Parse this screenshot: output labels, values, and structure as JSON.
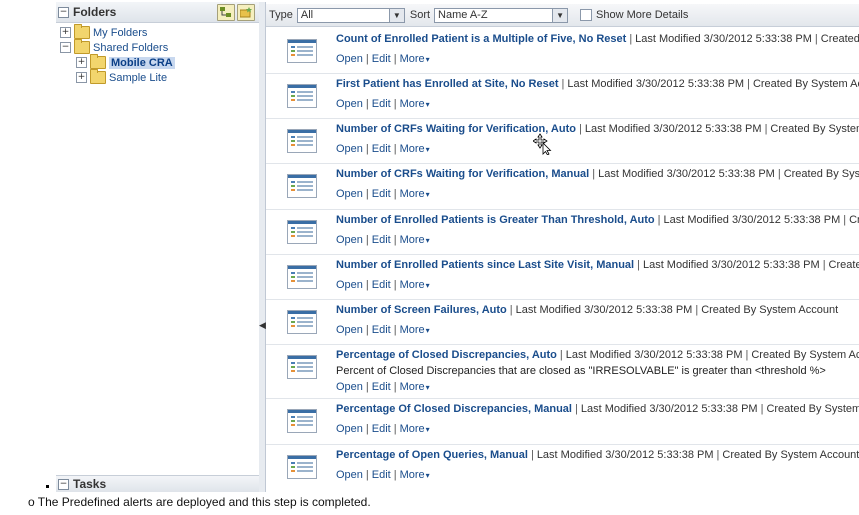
{
  "left_panel": {
    "folders_title": "Folders",
    "tree": [
      {
        "label": "My Folders",
        "level": 1,
        "expander": "+"
      },
      {
        "label": "Shared Folders",
        "level": 1,
        "expander": "−"
      },
      {
        "label": "Mobile CRA",
        "level": 2,
        "expander": "+",
        "selected": true
      },
      {
        "label": "Sample Lite",
        "level": 2,
        "expander": "+"
      }
    ],
    "tasks_title": "Tasks"
  },
  "toolbar": {
    "type_label": "Type",
    "type_value": "All",
    "sort_label": "Sort",
    "sort_value": "Name A-Z",
    "show_more_label": "Show More Details"
  },
  "item_links": {
    "open": "Open",
    "edit": "Edit",
    "more": "More"
  },
  "items": [
    {
      "title": "Count of Enrolled Patient is a Multiple of Five, No Reset",
      "modified": "Last Modified 3/30/2012 5:33:38 PM",
      "created": "Created By System Account"
    },
    {
      "title": "First Patient has Enrolled at Site, No Reset",
      "modified": "Last Modified 3/30/2012 5:33:38 PM",
      "created": "Created By System Account"
    },
    {
      "title": "Number of CRFs Waiting for Verification, Auto",
      "modified": "Last Modified 3/30/2012 5:33:38 PM",
      "created": "Created By System Account"
    },
    {
      "title": "Number of CRFs Waiting for Verification, Manual",
      "modified": "Last Modified 3/30/2012 5:33:38 PM",
      "created": "Created By System Account"
    },
    {
      "title": "Number of Enrolled Patients is Greater Than Threshold, Auto",
      "modified": "Last Modified 3/30/2012 5:33:38 PM",
      "created": "Created By System Account"
    },
    {
      "title": "Number of Enrolled Patients since Last Site Visit, Manual",
      "modified": "Last Modified 3/30/2012 5:33:38 PM",
      "created": "Created By System Account"
    },
    {
      "title": "Number of Screen Failures, Auto",
      "modified": "Last Modified 3/30/2012 5:33:38 PM",
      "created": "Created By System Account"
    },
    {
      "title": "Percentage of Closed Discrepancies, Auto",
      "modified": "Last Modified 3/30/2012 5:33:38 PM",
      "created": "Created By System Account",
      "description": "Percent of Closed Discrepancies that are closed as \"IRRESOLVABLE\" is greater than <threshold %>"
    },
    {
      "title": "Percentage Of Closed Discrepancies, Manual",
      "modified": "Last Modified 3/30/2012 5:33:38 PM",
      "created": "Created By System Account"
    },
    {
      "title": "Percentage of Open Queries, Manual",
      "modified": "Last Modified 3/30/2012 5:33:38 PM",
      "created": "Created By System Account"
    }
  ],
  "footer_note": "o The Predefined alerts are deployed and this step is completed.",
  "colors": {
    "link": "#1a4d8c",
    "selected_bg": "#c8d8ef",
    "folder": "#f2d56d"
  }
}
